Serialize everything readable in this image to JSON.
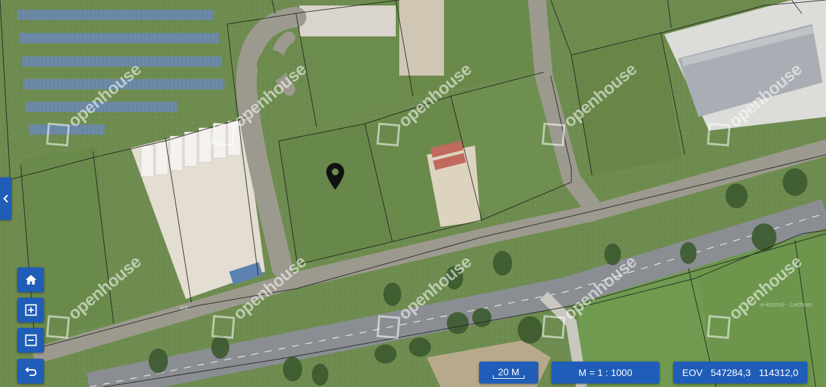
{
  "map": {
    "watermark_text": "openhouse",
    "attribution_left": "Kft.",
    "attribution_right": "e-közmű - Lechner",
    "marker_icon": "location-pin-icon"
  },
  "controls": {
    "collapse_icon": "chevron-left-icon",
    "home_icon": "home-icon",
    "zoom_in_icon": "zoom-in-icon",
    "zoom_out_icon": "zoom-out-icon",
    "back_icon": "undo-icon"
  },
  "status": {
    "scale_label": "20 M",
    "ratio_label": "M = 1 : 1000",
    "coord_prefix": "EOV",
    "coord_x": "547284,3",
    "coord_y": "114312,0"
  },
  "colors": {
    "accent": "#1f5db8"
  }
}
